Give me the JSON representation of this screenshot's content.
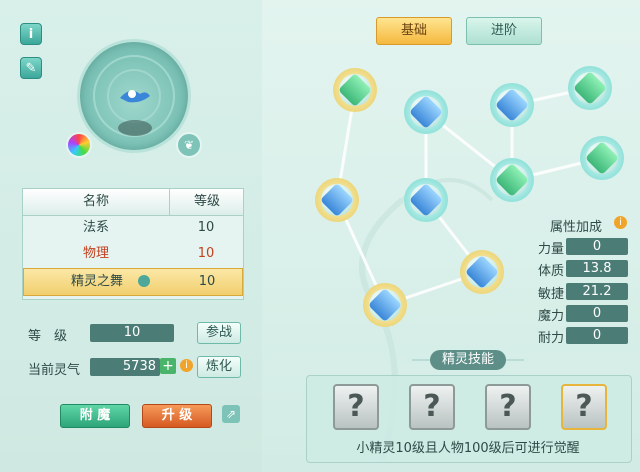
{
  "left": {
    "table": {
      "headers": {
        "name": "名称",
        "level": "等级"
      },
      "rows": [
        {
          "name": "法系",
          "level": "10"
        },
        {
          "name": "物理",
          "level": "10"
        },
        {
          "name": "精灵之舞",
          "level": "10"
        }
      ]
    },
    "level_label": "等　级",
    "level_value": "10",
    "join_button": "参战",
    "aura_label": "当前灵气",
    "aura_value": "5738",
    "refine_button": "炼化",
    "enchant_button": "附 魔",
    "upgrade_button": "升 级"
  },
  "right": {
    "tabs": {
      "basic": "基础",
      "advanced": "进阶"
    },
    "attr_title": "属性加成",
    "attributes": [
      {
        "label": "力量",
        "value": "0"
      },
      {
        "label": "体质",
        "value": "13.8"
      },
      {
        "label": "敏捷",
        "value": "21.2"
      },
      {
        "label": "魔力",
        "value": "0"
      },
      {
        "label": "耐力",
        "value": "0"
      }
    ],
    "skills_title": "精灵技能",
    "skill_slots": [
      "?",
      "?",
      "?",
      "?"
    ],
    "skills_note": "小精灵10级且人物100级后可进行觉醒"
  },
  "colors": {
    "accent_gold": "#f1cf6e",
    "red_text": "#c2401f",
    "teal": "#3ba79a",
    "enchant_green": "#3bbf8c",
    "upgrade_orange": "#e9743a"
  }
}
